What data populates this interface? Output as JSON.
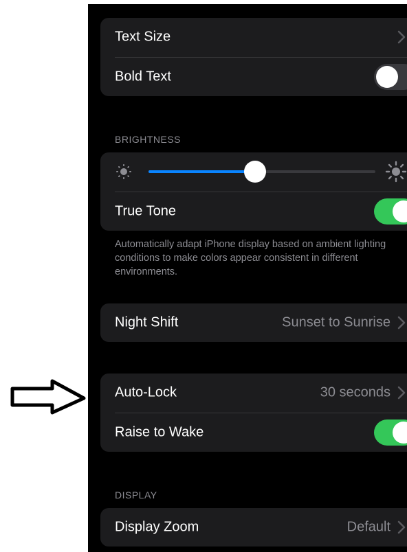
{
  "colors": {
    "background": "#000000",
    "cell": "#1c1c1e",
    "toggle_on": "#34c759",
    "slider_fill": "#0a84ff",
    "secondary_text": "#8d8d93"
  },
  "text_group": {
    "text_size_label": "Text Size",
    "bold_text_label": "Bold Text",
    "bold_text_on": false
  },
  "brightness": {
    "header": "BRIGHTNESS",
    "level": 0.47,
    "low_icon": "sun-low-icon",
    "high_icon": "sun-high-icon",
    "true_tone_label": "True Tone",
    "true_tone_on": true,
    "footer": "Automatically adapt iPhone display based on ambient lighting conditions to make colors appear consistent in different environments."
  },
  "night_shift": {
    "label": "Night Shift",
    "value": "Sunset to Sunrise"
  },
  "lock_group": {
    "auto_lock_label": "Auto-Lock",
    "auto_lock_value": "30 seconds",
    "raise_to_wake_label": "Raise to Wake",
    "raise_to_wake_on": true
  },
  "display": {
    "header": "DISPLAY",
    "zoom_label": "Display Zoom",
    "zoom_value": "Default"
  },
  "annotation": {
    "arrow_icon": "pointer-arrow-icon"
  }
}
